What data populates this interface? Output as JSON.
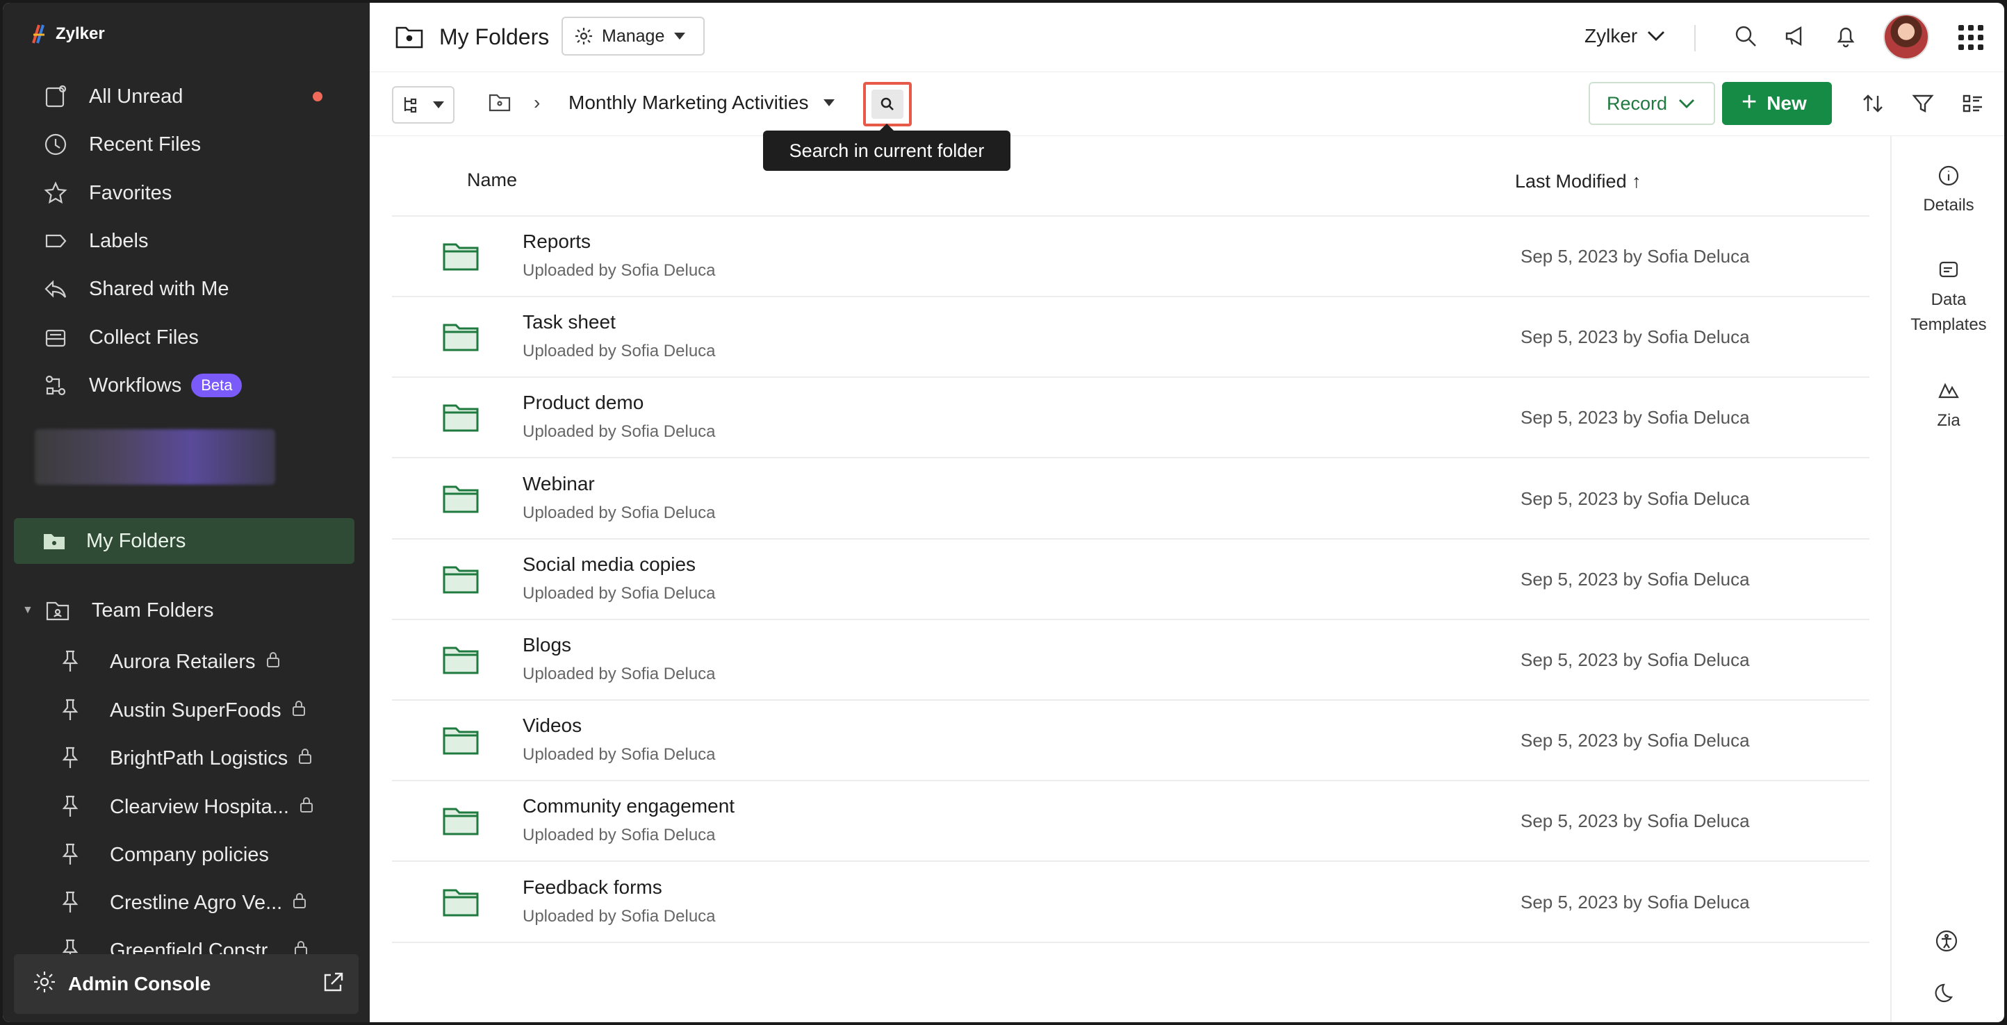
{
  "app": {
    "brand": "Zylker"
  },
  "sidebar": {
    "items": [
      {
        "label": "All Unread",
        "icon": "inbox-icon",
        "unread": true
      },
      {
        "label": "Recent Files",
        "icon": "clock-icon"
      },
      {
        "label": "Favorites",
        "icon": "star-icon"
      },
      {
        "label": "Labels",
        "icon": "label-icon"
      },
      {
        "label": "Shared with Me",
        "icon": "share-icon"
      },
      {
        "label": "Collect Files",
        "icon": "tray-icon"
      },
      {
        "label": "Workflows",
        "icon": "workflow-icon",
        "badge": "Beta"
      }
    ],
    "my_folders": "My Folders",
    "team_folders": {
      "label": "Team Folders",
      "items": [
        {
          "label": "Aurora Retailers",
          "locked": true
        },
        {
          "label": "Austin SuperFoods",
          "locked": true
        },
        {
          "label": "BrightPath Logistics",
          "locked": true
        },
        {
          "label": "Clearview Hospita...",
          "locked": true
        },
        {
          "label": "Company policies",
          "locked": false
        },
        {
          "label": "Crestline Agro Ve...",
          "locked": true
        },
        {
          "label": "Greenfield Constr...",
          "locked": true
        }
      ]
    },
    "admin_console": "Admin Console"
  },
  "header": {
    "title": "My Folders",
    "manage_label": "Manage",
    "org_name": "Zylker"
  },
  "toolbar": {
    "breadcrumb_current": "Monthly Marketing Activities",
    "search_tooltip": "Search in current folder",
    "record_label": "Record",
    "new_label": "New"
  },
  "list": {
    "col_name": "Name",
    "col_modified": "Last Modified ↑",
    "rows": [
      {
        "name": "Reports",
        "sub": "Uploaded by Sofia Deluca",
        "modified": "Sep 5, 2023 by Sofia Deluca"
      },
      {
        "name": "Task sheet",
        "sub": "Uploaded by Sofia Deluca",
        "modified": "Sep 5, 2023 by Sofia Deluca"
      },
      {
        "name": "Product demo",
        "sub": "Uploaded by Sofia Deluca",
        "modified": "Sep 5, 2023 by Sofia Deluca"
      },
      {
        "name": "Webinar",
        "sub": "Uploaded by Sofia Deluca",
        "modified": "Sep 5, 2023 by Sofia Deluca"
      },
      {
        "name": "Social media copies",
        "sub": "Uploaded by Sofia Deluca",
        "modified": "Sep 5, 2023 by Sofia Deluca"
      },
      {
        "name": "Blogs",
        "sub": "Uploaded by Sofia Deluca",
        "modified": "Sep 5, 2023 by Sofia Deluca"
      },
      {
        "name": "Videos",
        "sub": "Uploaded by Sofia Deluca",
        "modified": "Sep 5, 2023 by Sofia Deluca"
      },
      {
        "name": "Community engagement",
        "sub": "Uploaded by Sofia Deluca",
        "modified": "Sep 5, 2023 by Sofia Deluca"
      },
      {
        "name": "Feedback forms",
        "sub": "Uploaded by Sofia Deluca",
        "modified": "Sep 5, 2023 by Sofia Deluca"
      }
    ]
  },
  "right_panel": {
    "details": "Details",
    "data_templates_1": "Data",
    "data_templates_2": "Templates",
    "zia": "Zia"
  },
  "colors": {
    "accent": "#168b45",
    "sidebar_bg": "#262626",
    "highlight": "#e75a4a",
    "folder": "#1f7a3f"
  }
}
